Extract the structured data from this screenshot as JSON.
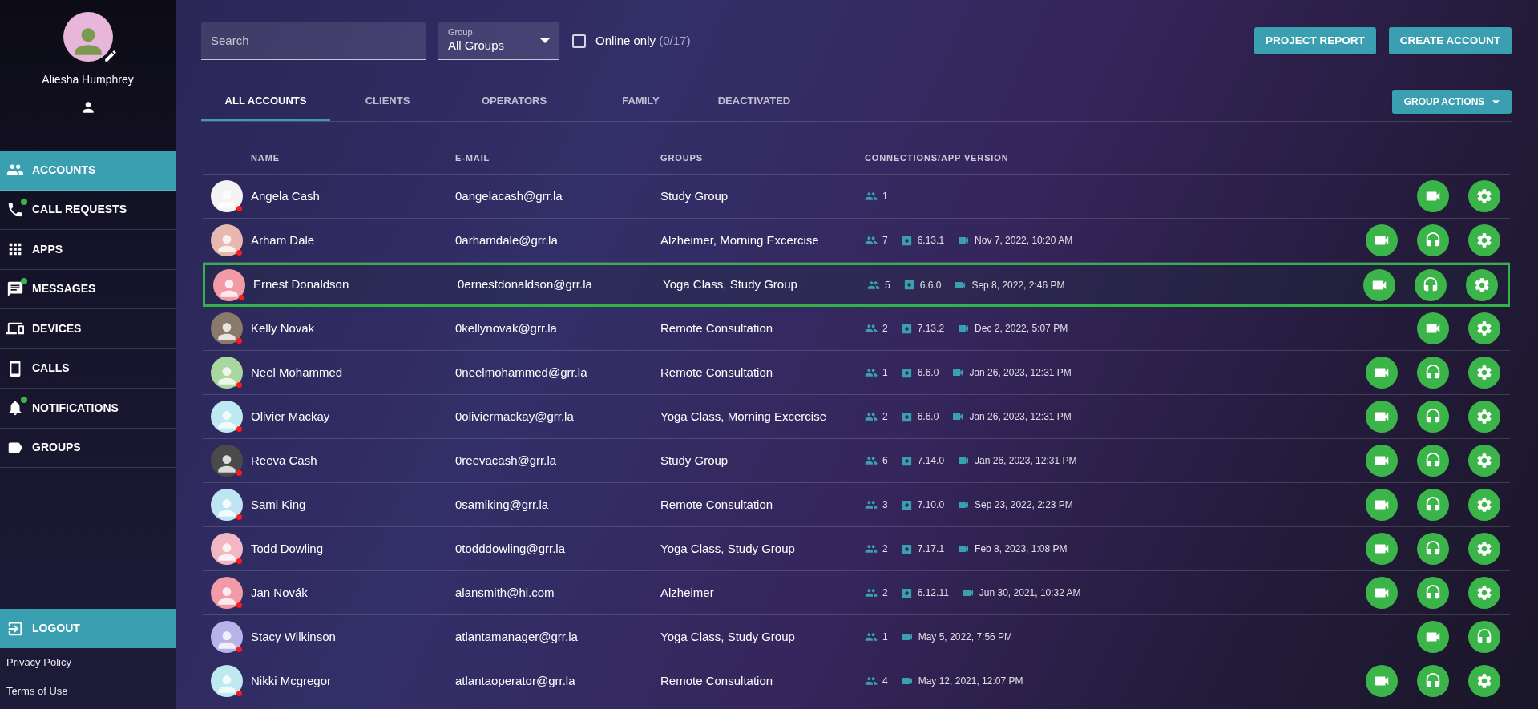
{
  "user": {
    "name": "Aliesha Humphrey"
  },
  "nav": [
    {
      "label": "ACCOUNTS",
      "selected": true,
      "badge": false
    },
    {
      "label": "CALL REQUESTS",
      "selected": false,
      "badge": true
    },
    {
      "label": "APPS",
      "selected": false,
      "badge": false
    },
    {
      "label": "MESSAGES",
      "selected": false,
      "badge": true
    },
    {
      "label": "DEVICES",
      "selected": false,
      "badge": false
    },
    {
      "label": "CALLS",
      "selected": false,
      "badge": false
    },
    {
      "label": "NOTIFICATIONS",
      "selected": false,
      "badge": true
    },
    {
      "label": "GROUPS",
      "selected": false,
      "badge": false
    }
  ],
  "logout": "LOGOUT",
  "footer_links": [
    "Privacy Policy",
    "Terms of Use"
  ],
  "search": {
    "placeholder": "Search"
  },
  "group_select": {
    "label": "Group",
    "value": "All Groups"
  },
  "online_only": {
    "label": "Online only",
    "count": "(0/17)",
    "checked": false
  },
  "buttons": [
    "PROJECT REPORT",
    "CREATE ACCOUNT"
  ],
  "tabs": [
    {
      "label": "ALL ACCOUNTS",
      "selected": true
    },
    {
      "label": "CLIENTS",
      "selected": false
    },
    {
      "label": "OPERATORS",
      "selected": false
    },
    {
      "label": "FAMILY",
      "selected": false
    },
    {
      "label": "DEACTIVATED",
      "selected": false
    }
  ],
  "group_actions": "GROUP ACTIONS",
  "table": {
    "columns": [
      "NAME",
      "E-MAIL",
      "GROUPS",
      "CONNECTIONS/APP VERSION"
    ],
    "rows": [
      {
        "name": "Angela Cash",
        "email": "0angelacash@grr.la",
        "groups": "Study Group",
        "connections": "1",
        "online": false,
        "selected": false,
        "actions": [
          {
            "kind": "video"
          },
          {
            "kind": "settings"
          }
        ]
      },
      {
        "name": "Arham Dale",
        "email": "0arhamdale@grr.la",
        "groups": "Alzheimer, Morning Excercise",
        "connections": "7",
        "app_version": "6.13.1",
        "last_call": "Nov 7, 2022, 10:20 AM",
        "online": false,
        "selected": false,
        "actions": [
          {
            "kind": "video"
          },
          {
            "kind": "headset"
          },
          {
            "kind": "settings"
          }
        ]
      },
      {
        "name": "Ernest Donaldson",
        "email": "0ernestdonaldson@grr.la",
        "groups": "Yoga Class, Study Group",
        "connections": "5",
        "app_version": "6.6.0",
        "last_call": "Sep 8, 2022, 2:46 PM",
        "online": false,
        "selected": true,
        "actions": [
          {
            "kind": "video"
          },
          {
            "kind": "headset"
          },
          {
            "kind": "settings"
          }
        ]
      },
      {
        "name": "Kelly Novak",
        "email": "0kellynovak@grr.la",
        "groups": "Remote Consultation",
        "connections": "2",
        "app_version": "7.13.2",
        "last_call": "Dec 2, 2022, 5:07 PM",
        "online": false,
        "selected": false,
        "actions": [
          {
            "kind": "video"
          },
          {
            "kind": "settings"
          }
        ]
      },
      {
        "name": "Neel Mohammed",
        "email": "0neelmohammed@grr.la",
        "groups": "Remote Consultation",
        "connections": "1",
        "app_version": "6.6.0",
        "last_call": "Jan 26, 2023, 12:31 PM",
        "online": false,
        "selected": false,
        "actions": [
          {
            "kind": "video"
          },
          {
            "kind": "headset"
          },
          {
            "kind": "settings"
          }
        ]
      },
      {
        "name": "Olivier Mackay",
        "email": "0oliviermackay@grr.la",
        "groups": "Yoga Class, Morning Excercise",
        "connections": "2",
        "app_version": "6.6.0",
        "last_call": "Jan 26, 2023, 12:31 PM",
        "online": false,
        "selected": false,
        "actions": [
          {
            "kind": "video"
          },
          {
            "kind": "headset"
          },
          {
            "kind": "settings"
          }
        ]
      },
      {
        "name": "Reeva Cash",
        "email": "0reevacash@grr.la",
        "groups": "Study Group",
        "connections": "6",
        "app_version": "7.14.0",
        "last_call": "Jan 26, 2023, 12:31 PM",
        "online": false,
        "selected": false,
        "actions": [
          {
            "kind": "video"
          },
          {
            "kind": "headset"
          },
          {
            "kind": "settings"
          }
        ]
      },
      {
        "name": "Sami King",
        "email": "0samiking@grr.la",
        "groups": "Remote Consultation",
        "connections": "3",
        "app_version": "7.10.0",
        "last_call": "Sep 23, 2022, 2:23 PM",
        "online": false,
        "selected": false,
        "actions": [
          {
            "kind": "video"
          },
          {
            "kind": "headset"
          },
          {
            "kind": "settings"
          }
        ]
      },
      {
        "name": "Todd Dowling",
        "email": "0todddowling@grr.la",
        "groups": "Yoga Class, Study Group",
        "connections": "2",
        "app_version": "7.17.1",
        "last_call": "Feb 8, 2023, 1:08 PM",
        "online": false,
        "selected": false,
        "actions": [
          {
            "kind": "video"
          },
          {
            "kind": "headset"
          },
          {
            "kind": "settings"
          }
        ]
      },
      {
        "name": "Jan Novák",
        "email": "alansmith@hi.com",
        "groups": "Alzheimer",
        "connections": "2",
        "app_version": "6.12.11",
        "last_call": "Jun 30, 2021, 10:32 AM",
        "online": false,
        "selected": false,
        "actions": [
          {
            "kind": "video"
          },
          {
            "kind": "headset"
          },
          {
            "kind": "settings"
          }
        ]
      },
      {
        "name": "Stacy Wilkinson",
        "email": "atlantamanager@grr.la",
        "groups": "Yoga Class, Study Group",
        "connections": "1",
        "last_call": "May 5, 2022, 7:56 PM",
        "online": false,
        "selected": false,
        "actions": [
          {
            "kind": "video"
          },
          {
            "kind": "headset"
          }
        ]
      },
      {
        "name": "Nikki Mcgregor",
        "email": "atlantaoperator@grr.la",
        "groups": "Remote Consultation",
        "connections": "4",
        "last_call": "May 12, 2021, 12:07 PM",
        "online": false,
        "selected": false,
        "actions": [
          {
            "kind": "video"
          },
          {
            "kind": "headset"
          },
          {
            "kind": "settings"
          }
        ]
      }
    ]
  }
}
